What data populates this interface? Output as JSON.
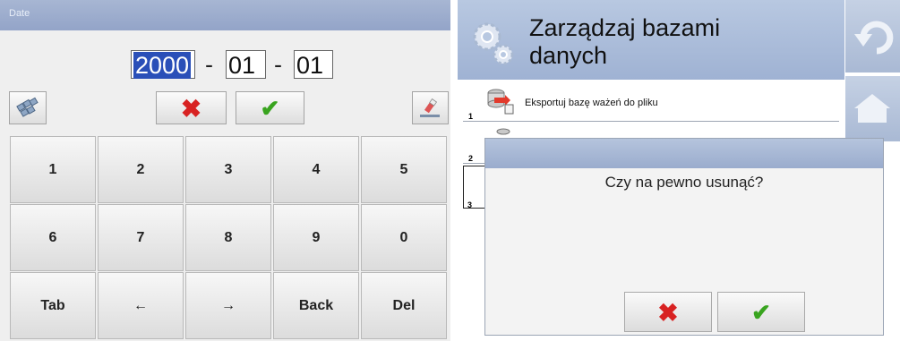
{
  "left_panel": {
    "title": "Date",
    "date": {
      "year": "2000",
      "sep1": "-",
      "month": "01",
      "sep2": "-",
      "day": "01"
    },
    "tools": {
      "keyboard_icon": "keyboard-layout-icon",
      "cancel_icon": "cross-icon",
      "confirm_icon": "checkmark-icon",
      "eraser_icon": "eraser-icon"
    },
    "keys": [
      "1",
      "2",
      "3",
      "4",
      "5",
      "6",
      "7",
      "8",
      "9",
      "0",
      "Tab",
      "←",
      "→",
      "Back",
      "Del"
    ]
  },
  "right_panel": {
    "header": {
      "title_line1": "Zarządzaj bazami",
      "title_line2": "danych",
      "icon": "gears-icon"
    },
    "side_buttons": {
      "top_icon": "undo-arrow-icon",
      "second_icon": "home-icon"
    },
    "list": [
      {
        "number": "1",
        "label": "Eksportuj bazę ważeń do pliku",
        "icon": "export-database-icon"
      },
      {
        "number": "2",
        "label": "",
        "icon": "database-icon"
      },
      {
        "number": "3",
        "label": "",
        "icon": "database-icon"
      }
    ],
    "dialog": {
      "message": "Czy na pewno usunąć?",
      "cancel_icon": "cross-icon",
      "confirm_icon": "checkmark-icon"
    }
  },
  "colors": {
    "header_blue": "#a7b6d3",
    "selection_blue": "#2a4fb8",
    "cancel_red": "#d82222",
    "confirm_green": "#39a41f",
    "panel_bg": "#efefef"
  }
}
